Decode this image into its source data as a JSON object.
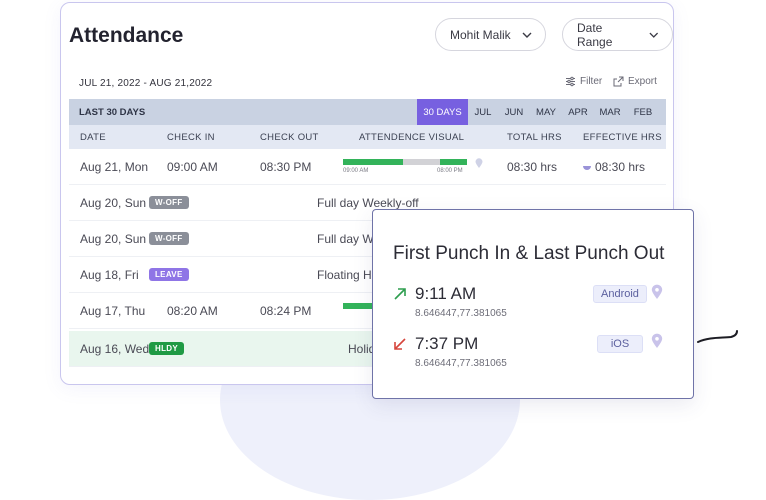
{
  "page": {
    "title": "Attendance",
    "employee_dropdown": "Mohit Malik",
    "date_range_dropdown": "Date Range",
    "date_span": "JUL 21, 2022 - AUG 21,2022",
    "filter_label": "Filter",
    "export_label": "Export"
  },
  "period": {
    "label": "LAST 30 DAYS",
    "tabs": [
      "30 DAYS",
      "JUL",
      "JUN",
      "MAY",
      "APR",
      "MAR",
      "FEB"
    ],
    "active": "30 DAYS"
  },
  "columns": [
    "DATE",
    "CHECK IN",
    "CHECK OUT",
    "ATTENDENCE VISUAL",
    "TOTAL HRS",
    "EFFECTIVE HRS"
  ],
  "rows": [
    {
      "date": "Aug 21, Mon",
      "check_in": "09:00 AM",
      "check_out": "08:30 PM",
      "bar_start_label": "09:00 AM",
      "bar_end_label": "08:00 PM",
      "total": "08:30 hrs",
      "effective": "08:30 hrs"
    },
    {
      "date": "Aug 20, Sun",
      "badge": "W-OFF",
      "note": "Full day Weekly-off"
    },
    {
      "date": "Aug 20, Sun",
      "badge": "W-OFF",
      "note": "Full day Weekly-off"
    },
    {
      "date": "Aug 18, Fri",
      "badge": "LEAVE",
      "note": "Floating Ho"
    },
    {
      "date": "Aug 17, Thu",
      "check_in": "08:20 AM",
      "check_out": "08:24 PM"
    },
    {
      "date": "Aug 16, Wed",
      "badge": "HLDY",
      "note": "Holid"
    }
  ],
  "popup": {
    "title": "First Punch In & Last Punch Out",
    "punches": [
      {
        "time": "9:11 AM",
        "coords": "8.646447,77.381065",
        "device": "Android",
        "direction": "in"
      },
      {
        "time": "7:37 PM",
        "coords": "8.646447,77.381065",
        "device": "iOS",
        "direction": "out"
      }
    ]
  },
  "colors": {
    "accent": "#7760e0",
    "present_bar": "#33b35a",
    "holiday_row": "#e9f6ee",
    "punch_in_arrow": "#2e9e4f",
    "punch_out_arrow": "#d6453c"
  }
}
